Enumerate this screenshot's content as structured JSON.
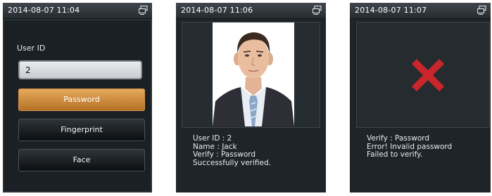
{
  "screens": [
    {
      "status_time": "2014-08-07 11:04",
      "user_id_label": "User ID",
      "user_id_value": "2",
      "buttons": {
        "password": "Password",
        "fingerprint": "Fingerprint",
        "face": "Face"
      }
    },
    {
      "status_time": "2014-08-07 11:06",
      "lines": [
        "User ID : 2",
        "Name : Jack",
        "Verify : Password",
        "Successfully verified."
      ]
    },
    {
      "status_time": "2014-08-07 11:07",
      "lines": [
        "Verify : Password",
        "Error! Invalid password",
        "Failed to verify."
      ]
    }
  ],
  "icons": {
    "status_right": "network-icon",
    "fail_mark": "red-x-icon"
  },
  "colors": {
    "accent": "#d18a3c",
    "error": "#c8262a",
    "panel_bg": "#1e2428"
  }
}
